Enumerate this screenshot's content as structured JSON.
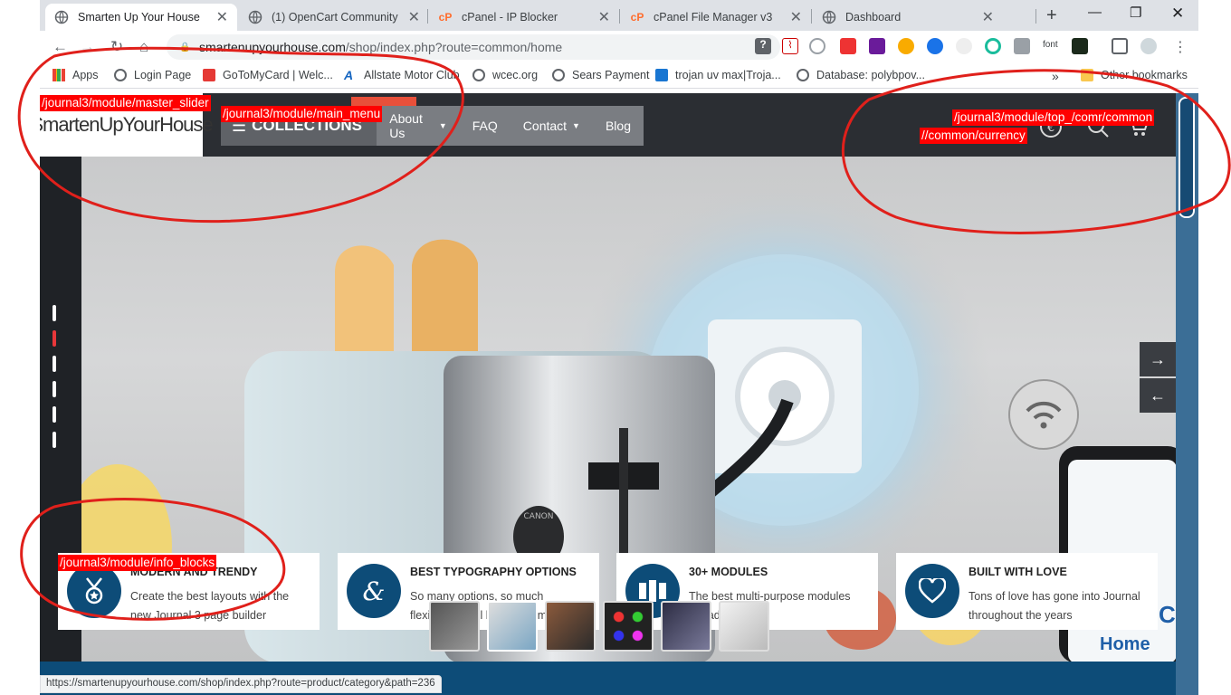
{
  "browser": {
    "tabs": [
      {
        "title": "Smarten Up Your House",
        "active": true
      },
      {
        "title": "(1) OpenCart Community - ",
        "active": false
      },
      {
        "title": "cPanel - IP Blocker",
        "active": false
      },
      {
        "title": "cPanel File Manager v3",
        "active": false
      },
      {
        "title": "Dashboard",
        "active": false
      }
    ],
    "url_host": "smartenupyourhouse.com",
    "url_path": "/shop/index.php?route=common/home",
    "ext_font_label": "font",
    "bookmarks": [
      "Apps",
      "Login Page",
      "GoToMyCard | Welc...",
      "Allstate Motor Club",
      "wcec.org",
      "Sears Payment",
      "trojan uv max|Troja...",
      "Database: polybpov...",
      "Other bookmarks"
    ],
    "bookmarks_overflow": "»",
    "status_url": "https://smartenupyourhouse.com/shop/index.php?route=product/category&path=236"
  },
  "site": {
    "logo": "SmartenUpYourHouse",
    "menu": {
      "collections": "COLLECTIONS",
      "items": [
        {
          "label": "About Us",
          "has_caret": true
        },
        {
          "label": "FAQ",
          "has_caret": false
        },
        {
          "label": "Contact",
          "has_caret": true
        },
        {
          "label": "Blog",
          "has_caret": false
        }
      ]
    },
    "debug_labels": {
      "master_slider": "/journal3/module/master_slider",
      "main_menu": "/journal3/module/main_menu",
      "top": "/journal3/module/top_/comr/common",
      "currency": "//common/currency",
      "info_blocks": "/journal3/module/info_blocks"
    },
    "info_blocks": [
      {
        "title": "MODERN AND TRENDY",
        "text": "Create the best layouts with the new Journal 3 page builder",
        "icon": "medal-icon"
      },
      {
        "title": "BEST TYPOGRAPHY OPTIONS",
        "text": "So many options, so much flexibility, it will blow your mind",
        "icon": "ampersand-icon"
      },
      {
        "title": "30+ MODULES",
        "text": "The best multi-purpose modules already built-in",
        "icon": "modules-icon"
      },
      {
        "title": "BUILT WITH LOVE",
        "text": "Tons of love has gone into Journal throughout the years",
        "icon": "heart-icon"
      }
    ],
    "slide_text": {
      "right_c": "C",
      "right_home": "Home",
      "toaster_brand": "CANON"
    }
  },
  "colors": {
    "header_bg": "#2b2e33",
    "accent_blue": "#0d4c78",
    "annotation_red": "#ff0000"
  }
}
